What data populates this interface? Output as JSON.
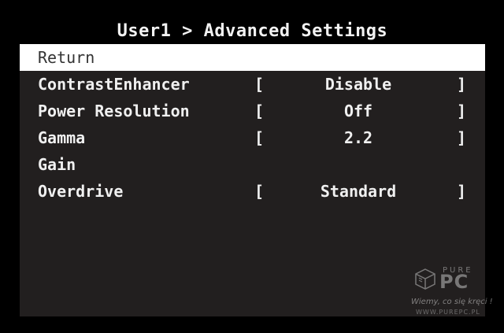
{
  "osd": {
    "title": "User1 > Advanced Settings",
    "menu": [
      {
        "label": "Return",
        "selected": true
      },
      {
        "label": "ContrastEnhancer",
        "value": "Disable"
      },
      {
        "label": "Power Resolution",
        "value": "Off"
      },
      {
        "label": "Gamma",
        "value": "2.2"
      },
      {
        "label": "Gain"
      },
      {
        "label": "Overdrive",
        "value": "Standard"
      }
    ],
    "bracket_open": "[",
    "bracket_close": "]"
  },
  "watermark": {
    "brand_top": "PURE",
    "brand_main": "PC",
    "slogan": "Wiemy, co się kręci !",
    "url": "WWW.PUREPC.PL",
    "icon": "purepc-cube-logo"
  },
  "colors": {
    "screen_bg": "#000000",
    "panel_bg": "#221f1f",
    "text": "#f0f0f0",
    "selected_bg": "#ffffff",
    "selected_text": "#333333"
  }
}
